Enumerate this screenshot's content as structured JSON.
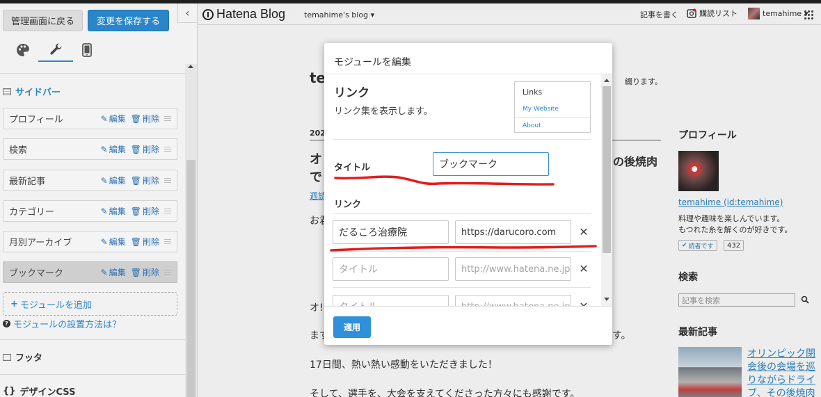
{
  "editor": {
    "back_label": "管理画面に戻る",
    "save_label": "変更を保存する",
    "sidebar_heading": "サイドバー",
    "modules": [
      {
        "label": "プロフィール",
        "edit": "編集",
        "delete": "削除"
      },
      {
        "label": "検索",
        "edit": "編集",
        "delete": "削除"
      },
      {
        "label": "最新記事",
        "edit": "編集",
        "delete": "削除"
      },
      {
        "label": "カテゴリー",
        "edit": "編集",
        "delete": "削除"
      },
      {
        "label": "月別アーカイブ",
        "edit": "編集",
        "delete": "削除"
      },
      {
        "label": "ブックマーク",
        "edit": "編集",
        "delete": "削除"
      }
    ],
    "add_module_label": "モジュールを追加",
    "howto_label": "モジュールの設置方法は？",
    "footer_heading": "フッタ",
    "css_heading": "デザインCSS",
    "accent_color": "#2a86c9"
  },
  "blog": {
    "logo_text": "Hatena Blog",
    "blog_name": "temahime's blog",
    "write_label": "記事を書く",
    "reading_list_label": "購読リスト",
    "user_name": "temahime",
    "title_fragment": "te",
    "desc_fragment": "綴ります。",
    "date_fragment": "202",
    "article_title_fragment_1": "オ",
    "article_title_fragment_2": "で",
    "article_title_right": "の後焼肉",
    "link_fragment": "週読",
    "body_1": "お君",
    "body_2": "オ!",
    "body_3": "ます",
    "body_3_end": "す。",
    "body_4": "17日間、熱い熱い感動をいただきました！",
    "body_5": "そして、選手を、大会を支えてくださった方々にも感謝です。",
    "sidebar": {
      "profile_heading": "プロフィール",
      "profile_name": "temahime (id:temahime)",
      "profile_desc_1": "料理や趣味を楽しんでいます。",
      "profile_desc_2": "もつれた糸を解くのが好きです。",
      "reader_label": "読者です",
      "reader_count": "432",
      "search_heading": "検索",
      "search_placeholder": "記事を検索",
      "recent_heading": "最新記事",
      "recent_link": "オリンピック閉会後の会場を巡りながらドライブ、その後焼肉"
    }
  },
  "modal": {
    "title": "モジュールを編集",
    "module_name": "リンク",
    "module_desc": "リンク集を表示します。",
    "preview": {
      "title": "Links",
      "link1": "My Website",
      "link2": "About"
    },
    "title_label": "タイトル",
    "title_value": "ブックマーク",
    "links_label": "リンク",
    "rows": [
      {
        "title": "だるころ治療院",
        "url": "https://darucoro.com",
        "title_placeholder": "",
        "url_placeholder": ""
      },
      {
        "title": "",
        "url": "",
        "title_placeholder": "タイトル",
        "url_placeholder": "http://www.hatena.ne.jp"
      },
      {
        "title": "",
        "url": "",
        "title_placeholder": "タイトル",
        "url_placeholder": "http://www.hatena.ne.jp"
      }
    ],
    "remove_glyph": "✕",
    "apply_label": "適用",
    "annotation_color": "#e01e1e"
  }
}
